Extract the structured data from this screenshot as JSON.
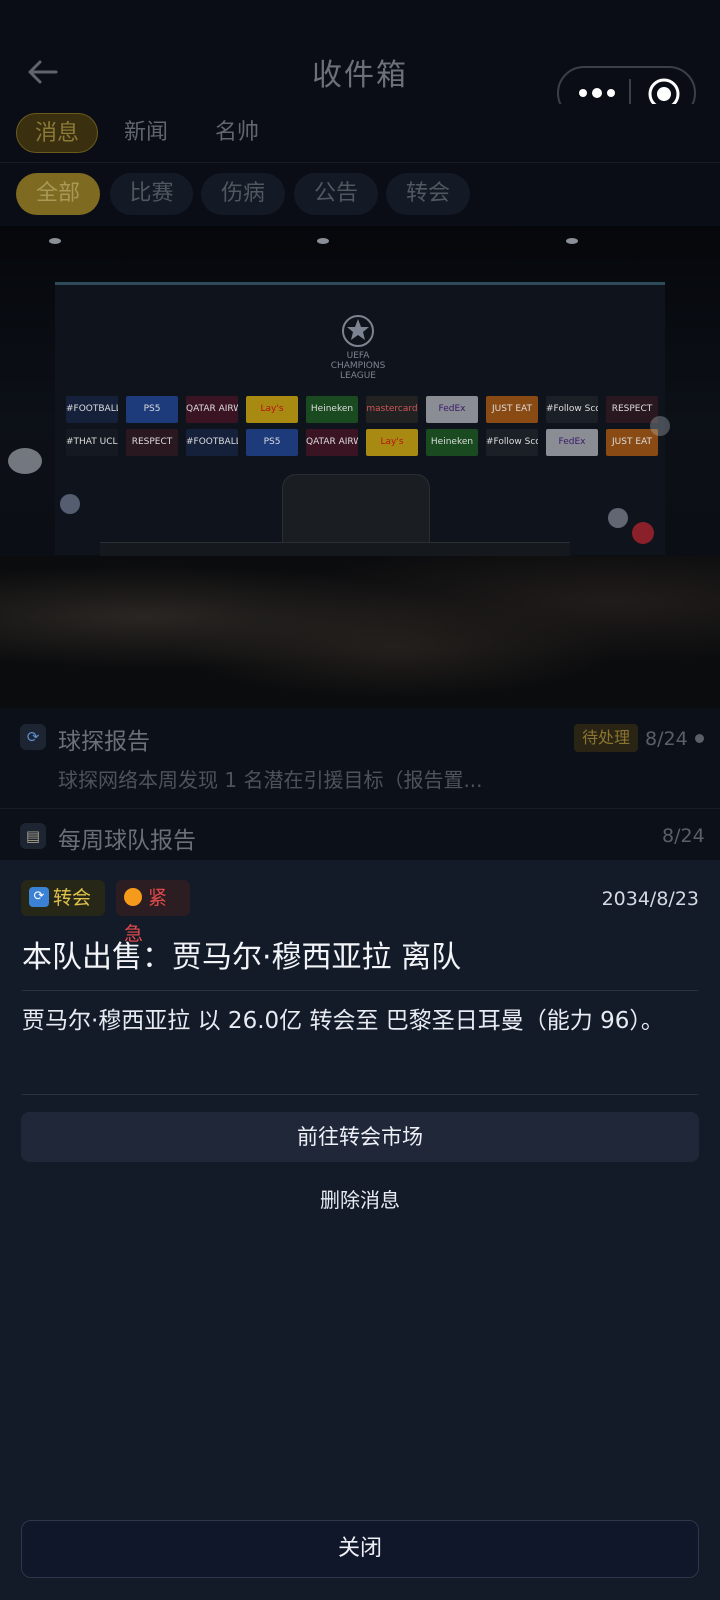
{
  "header": {
    "title": "收件箱"
  },
  "tabs": [
    {
      "label": "消息",
      "active": true
    },
    {
      "label": "新闻",
      "active": false
    },
    {
      "label": "名帅",
      "active": false
    }
  ],
  "filters": [
    {
      "label": "全部",
      "active": true
    },
    {
      "label": "比赛",
      "active": false
    },
    {
      "label": "伤病",
      "active": false
    },
    {
      "label": "公告",
      "active": false
    },
    {
      "label": "转会",
      "active": false
    }
  ],
  "hero": {
    "logo_text": "UEFA CHAMPIONS LEAGUE",
    "sponsors_row1": [
      "#FOOTBALL",
      "PS5",
      "QATAR AIRWAYS",
      "Lay's",
      "Heineken",
      "mastercard",
      "FedEx",
      "JUST EAT",
      "#Follow Scores",
      "RESPECT"
    ],
    "sponsors_row2": [
      "#THAT UCLFEELING",
      "RESPECT",
      "#FOOTBALL",
      "PS5",
      "QATAR AIRWAYS",
      "Lay's",
      "Heineken",
      "#Follow Scores",
      "FedEx",
      "JUST EAT"
    ]
  },
  "messages": [
    {
      "title": "球探报告",
      "subtitle": "球探网络本周发现 1 名潜在引援目标（报告置...",
      "status": "待处理",
      "date": "8/24",
      "icon": "refresh-icon"
    },
    {
      "title": "每周球队报告",
      "subtitle": "",
      "date": "8/24",
      "icon": "clipboard-icon"
    }
  ],
  "detail": {
    "category_tag": "转会",
    "priority_tag": "紧急",
    "date": "2034/8/23",
    "title": "本队出售：贾马尔·穆西亚拉 离队",
    "body": "贾马尔·穆西亚拉 以 26.0亿 转会至 巴黎圣日耳曼（能力 96）。",
    "primary_action": "前往转会市场",
    "secondary_action": "删除消息",
    "close_label": "关闭"
  },
  "colors": {
    "accent_gold": "#7e6a21",
    "urgent": "#e04b4b",
    "transfer": "#e0c24a",
    "sheet_bg": "#131a28"
  }
}
